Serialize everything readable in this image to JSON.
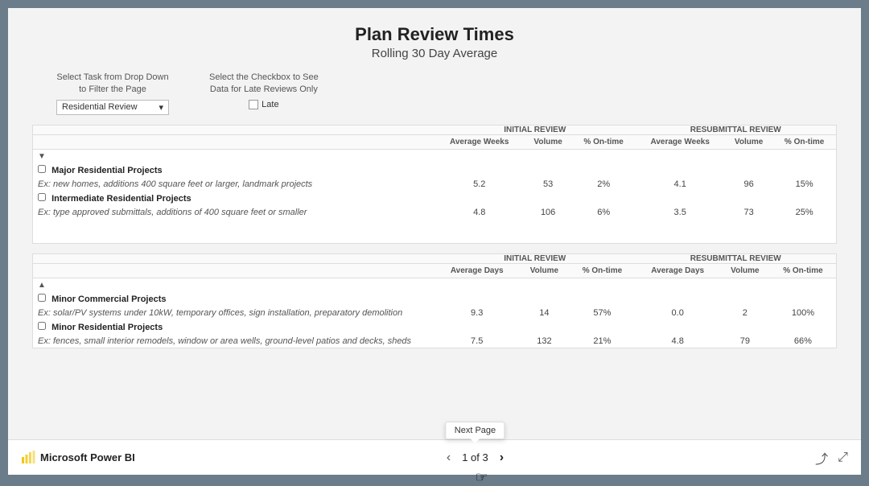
{
  "header": {
    "title": "Plan Review Times",
    "subtitle": "Rolling 30 Day Average"
  },
  "controls": {
    "task_filter_label": "Select Task from Drop Down\nto Filter the Page",
    "late_filter_label": "Select the Checkbox to See\nData for Late Reviews Only",
    "dropdown_value": "Residential Review",
    "checkbox_label": "Late"
  },
  "table1": {
    "group_header_initial": "INITIAL REVIEW",
    "group_header_resubmittal": "RESUBMITTAL REVIEW",
    "cols_initial": [
      "Average Weeks",
      "Volume",
      "% On-time"
    ],
    "cols_resubmittal": [
      "Average Weeks",
      "Volume",
      "% On-time"
    ],
    "categories": [
      {
        "name": "Major Residential Projects",
        "description": "Ex: new homes, additions 400 square feet or larger, landmark projects",
        "initial_avg": "5.2",
        "initial_vol": "53",
        "initial_pct": "2%",
        "resub_avg": "4.1",
        "resub_vol": "96",
        "resub_pct": "15%"
      },
      {
        "name": "Intermediate Residential Projects",
        "description": "Ex: type approved submittals, additions of 400 square feet or smaller",
        "initial_avg": "4.8",
        "initial_vol": "106",
        "initial_pct": "6%",
        "resub_avg": "3.5",
        "resub_vol": "73",
        "resub_pct": "25%"
      }
    ]
  },
  "table2": {
    "group_header_initial": "INITIAL REVIEW",
    "group_header_resubmittal": "RESUBMITTAL REVIEW",
    "cols_initial": [
      "Average Days",
      "Volume",
      "% On-time"
    ],
    "cols_resubmittal": [
      "Average Days",
      "Volume",
      "% On-time"
    ],
    "categories": [
      {
        "name": "Minor Commercial Projects",
        "description": "Ex: solar/PV systems under 10kW, temporary offices, sign installation, preparatory demolition",
        "initial_avg": "9.3",
        "initial_vol": "14",
        "initial_pct": "57%",
        "resub_avg": "0.0",
        "resub_vol": "2",
        "resub_pct": "100%"
      },
      {
        "name": "Minor Residential Projects",
        "description": "Ex: fences, small interior remodels, window or area wells, ground-level patios and decks, sheds",
        "initial_avg": "7.5",
        "initial_vol": "132",
        "initial_pct": "21%",
        "resub_avg": "4.8",
        "resub_vol": "79",
        "resub_pct": "66%"
      }
    ]
  },
  "pagination": {
    "current": "1 of 3",
    "prev_label": "‹",
    "next_label": "›",
    "tooltip": "Next Page"
  },
  "bottom_bar": {
    "app_name": "Microsoft Power BI"
  },
  "icons": {
    "share": "⤴",
    "expand": "⤢"
  }
}
